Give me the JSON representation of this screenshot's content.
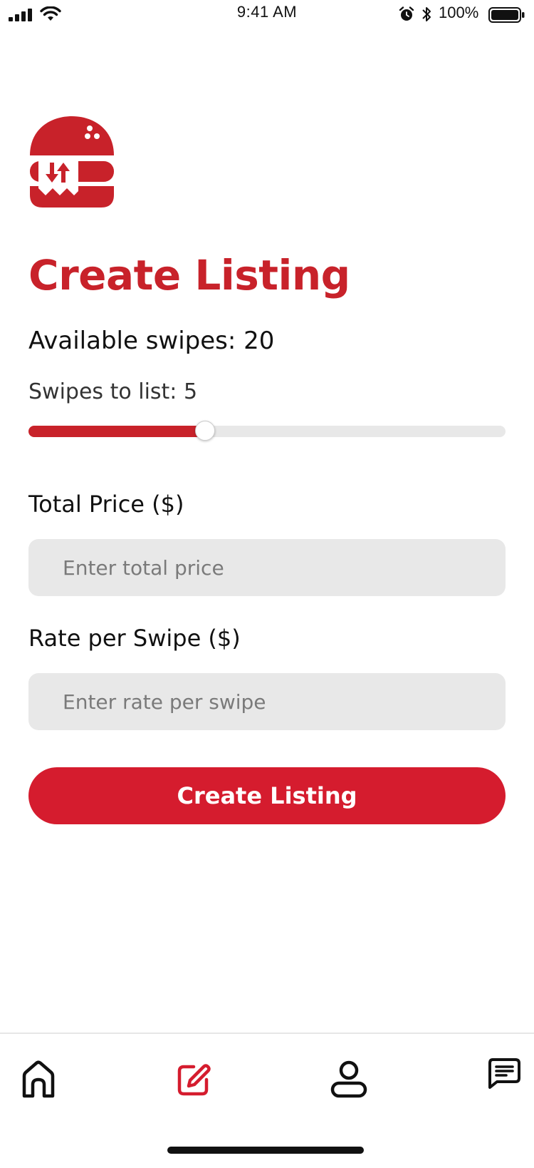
{
  "status_bar": {
    "time": "9:41 AM",
    "battery_percent": "100%",
    "icons": [
      "signal-icon",
      "wifi-icon",
      "alarm-icon",
      "bluetooth-icon",
      "battery-icon"
    ]
  },
  "brand": {
    "logo_icon": "burger-logo-icon",
    "accent_color": "#c8222a",
    "button_color": "#d51c2e"
  },
  "page": {
    "title": "Create Listing",
    "available_label": "Available swipes:",
    "available_value": "20",
    "swipes_label": "Swipes to list:",
    "swipes_value": "5"
  },
  "slider": {
    "value": 5,
    "max": 14,
    "fill_fraction": 0.37
  },
  "form": {
    "total_price": {
      "label": "Total Price ($)",
      "placeholder": "Enter total price",
      "value": ""
    },
    "rate_per_swipe": {
      "label": "Rate per Swipe ($)",
      "placeholder": "Enter rate per swipe",
      "value": ""
    },
    "submit_label": "Create Listing"
  },
  "tab_bar": {
    "items": [
      {
        "name": "home",
        "icon": "home-icon",
        "active": false
      },
      {
        "name": "create",
        "icon": "edit-icon",
        "active": true
      },
      {
        "name": "profile",
        "icon": "user-icon",
        "active": false
      },
      {
        "name": "messages",
        "icon": "chat-icon",
        "active": false
      }
    ],
    "active_color": "#d51c2e",
    "inactive_color": "#111111"
  }
}
